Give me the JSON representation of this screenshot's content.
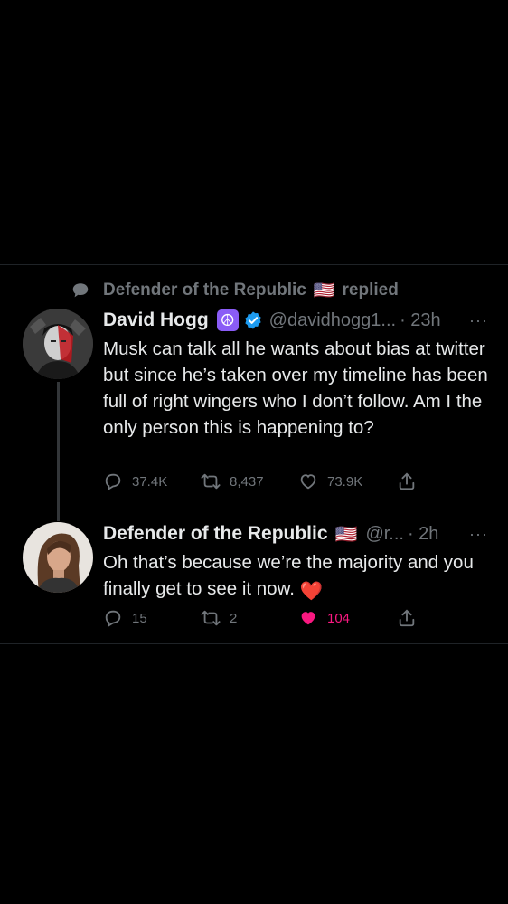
{
  "context": {
    "name": "Defender of the Republic",
    "flag": "🇺🇸",
    "action": "replied"
  },
  "tweets": [
    {
      "name": "David Hogg",
      "badge_emoji": "☮",
      "handle": "@davidhogg1...",
      "time": "· 23h",
      "more": "···",
      "text": "Musk can talk all he wants about bias at twitter but since he’s taken over my timeline has been full of right wingers who I don’t follow. Am I the only person this is happening to?",
      "replies": "37.4K",
      "retweets": "8,437",
      "likes": "73.9K"
    },
    {
      "name": "Defender of the Republic",
      "flag": "🇺🇸",
      "handle": "@r...",
      "time": "· 2h",
      "more": "···",
      "text": "Oh that’s because we’re the majority and you finally get to see it now.",
      "heart_emoji": "❤️",
      "replies": "15",
      "retweets": "2",
      "likes": "104"
    }
  ],
  "colors": {
    "background": "#000000",
    "text": "#e7e9ea",
    "muted": "#71767b",
    "verified": "#1d9bf0",
    "like": "#f91880",
    "peace_badge": "#8a5cf6"
  }
}
